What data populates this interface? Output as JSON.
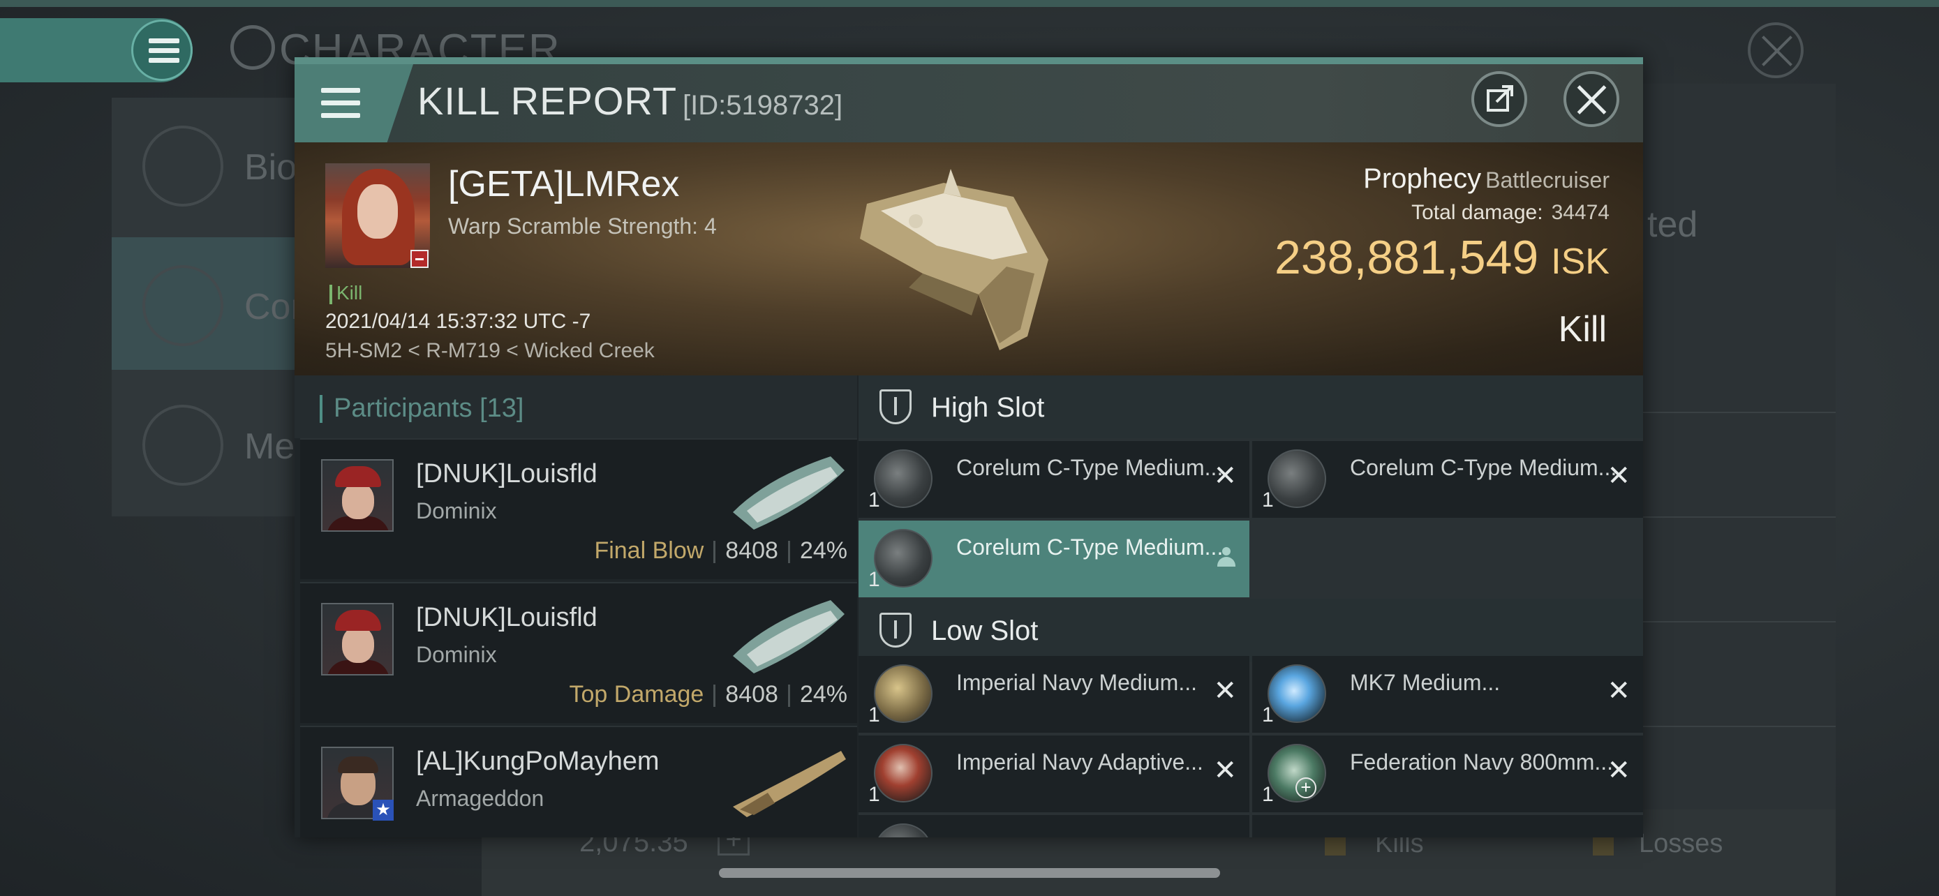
{
  "background": {
    "title": "CHARACTER",
    "sidebar": [
      {
        "label": "Bio"
      },
      {
        "label": "Cor"
      },
      {
        "label": "Med"
      }
    ],
    "right_text": "ted",
    "bottom_value": "2,075.35",
    "bottom_plus": "+",
    "kills_label": "Kills",
    "losses_label": "Losses"
  },
  "kill_report": {
    "title": "KILL REPORT",
    "id": "[ID:5198732]",
    "victim": {
      "name": "[GETA]LMRex",
      "warp_scramble": "Warp Scramble Strength: 4",
      "kill_tag": "Kill",
      "datetime": "2021/04/14 15:37:32 UTC -7",
      "location": "5H-SM2 < R-M719 < Wicked Creek"
    },
    "ship": {
      "name": "Prophecy",
      "class": "Battlecruiser",
      "total_damage_label": "Total damage:",
      "total_damage_value": "34474",
      "isk_value": "238,881,549",
      "isk_unit": "ISK",
      "result": "Kill"
    },
    "participants": {
      "label": "Participants",
      "count": "[13]",
      "items": [
        {
          "name": "[DNUK]Louisfld",
          "ship": "Dominix",
          "tag": "Final Blow",
          "damage": "8408",
          "percent": "24%"
        },
        {
          "name": "[DNUK]Louisfld",
          "ship": "Dominix",
          "tag": "Top Damage",
          "damage": "8408",
          "percent": "24%"
        },
        {
          "name": "[AL]KungPoMayhem",
          "ship": "Armageddon",
          "tag": "",
          "damage": "",
          "percent": ""
        }
      ]
    },
    "high_slot": {
      "label": "High Slot",
      "modules": [
        {
          "name": "Corelum C-Type Medium...",
          "qty": "1"
        },
        {
          "name": "Corelum C-Type Medium...",
          "qty": "1"
        },
        {
          "name": "Corelum C-Type Medium...",
          "qty": "1"
        }
      ]
    },
    "low_slot": {
      "label": "Low Slot",
      "modules": [
        {
          "name": "Imperial Navy Medium...",
          "qty": "1"
        },
        {
          "name": "MK7 Medium...",
          "qty": "1"
        },
        {
          "name": "Imperial Navy Adaptive...",
          "qty": "1"
        },
        {
          "name": "Federation Navy 800mm...",
          "qty": "1"
        }
      ]
    },
    "colors": {
      "accent": "#4d837b",
      "isk": "#f5cf86",
      "tag": "#c2a86a",
      "kill": "#7bb56e"
    }
  }
}
